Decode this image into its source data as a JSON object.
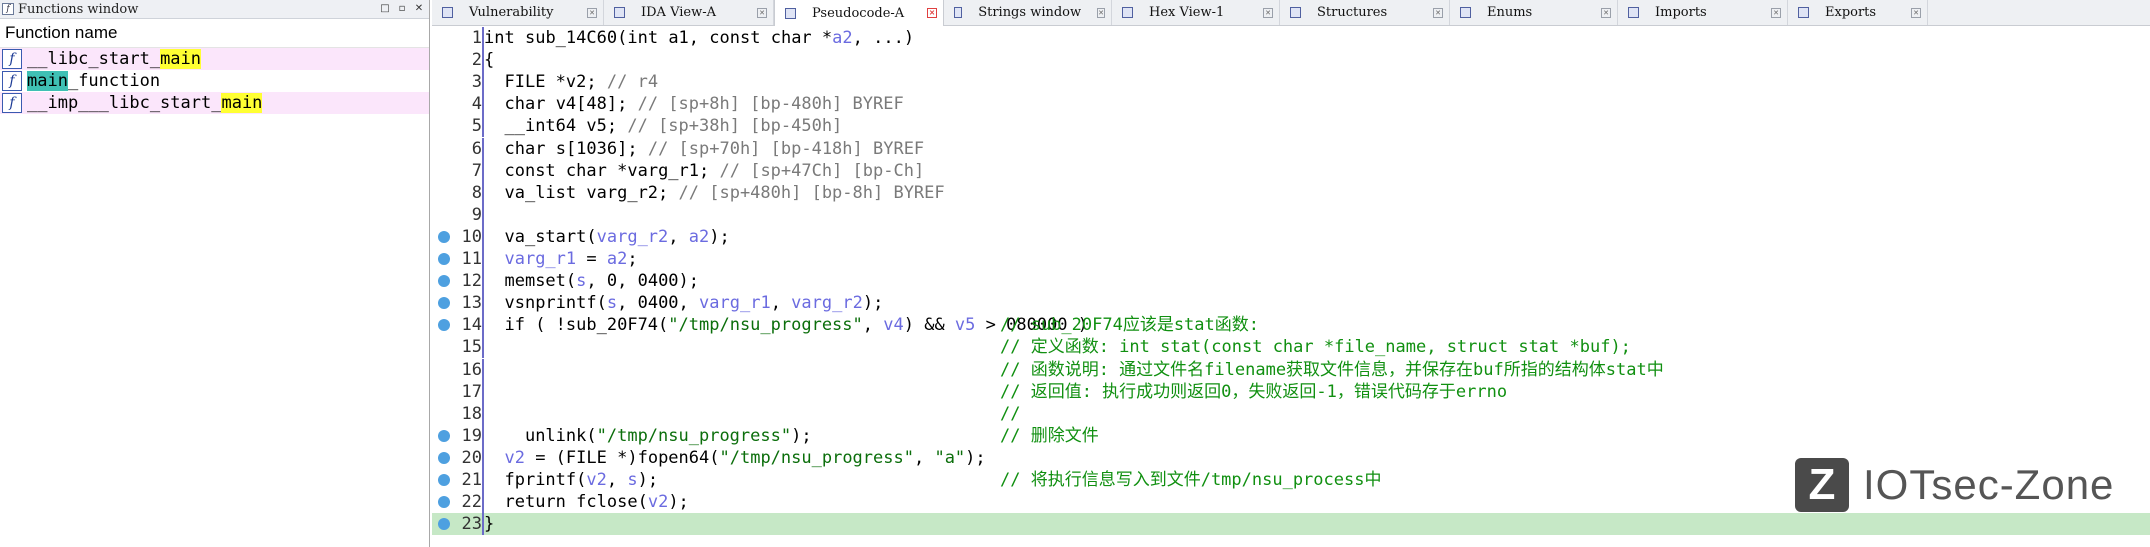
{
  "functions_window": {
    "title": "Functions window",
    "column_header": "Function name",
    "items": [
      {
        "pre": "__libc_start_",
        "hl": "main",
        "post": "",
        "hl_color": "yellow",
        "pink": true
      },
      {
        "pre": "",
        "hl": "main",
        "post": "_function",
        "hl_color": "cyan",
        "pink": false
      },
      {
        "pre": "__imp___libc_start_",
        "hl": "main",
        "post": "",
        "hl_color": "yellow",
        "pink": true
      }
    ]
  },
  "tabs": [
    {
      "label": "Vulnerability",
      "active": false
    },
    {
      "label": "IDA View-A",
      "active": false
    },
    {
      "label": "Pseudocode-A",
      "active": true
    },
    {
      "label": "Strings window",
      "active": false
    },
    {
      "label": "Hex View-1",
      "active": false
    },
    {
      "label": "Structures",
      "active": false
    },
    {
      "label": "Enums",
      "active": false
    },
    {
      "label": "Imports",
      "active": false
    },
    {
      "label": "Exports",
      "active": false
    }
  ],
  "code": {
    "current_line": 23,
    "lines": [
      {
        "n": "1",
        "bp": false,
        "text": "int sub_14C60(int a1, const char *a2, ...)",
        "comment": ""
      },
      {
        "n": "2",
        "bp": false,
        "text": "{",
        "comment": ""
      },
      {
        "n": "3",
        "bp": false,
        "text": "  FILE *v2; // r4",
        "comment": ""
      },
      {
        "n": "4",
        "bp": false,
        "text": "  char v4[48]; // [sp+8h] [bp-480h] BYREF",
        "comment": ""
      },
      {
        "n": "5",
        "bp": false,
        "text": "  __int64 v5; // [sp+38h] [bp-450h]",
        "comment": ""
      },
      {
        "n": "6",
        "bp": false,
        "text": "  char s[1036]; // [sp+70h] [bp-418h] BYREF",
        "comment": ""
      },
      {
        "n": "7",
        "bp": false,
        "text": "  const char *varg_r1; // [sp+47Ch] [bp-Ch]",
        "comment": ""
      },
      {
        "n": "8",
        "bp": false,
        "text": "  va_list varg_r2; // [sp+480h] [bp-8h] BYREF",
        "comment": ""
      },
      {
        "n": "9",
        "bp": false,
        "text": "",
        "comment": ""
      },
      {
        "n": "10",
        "bp": true,
        "text": "  va_start(varg_r2, a2);",
        "comment": ""
      },
      {
        "n": "11",
        "bp": true,
        "text": "  varg_r1 = a2;",
        "comment": ""
      },
      {
        "n": "12",
        "bp": true,
        "text": "  memset(s, 0, 0x400u);",
        "comment": ""
      },
      {
        "n": "13",
        "bp": true,
        "text": "  vsnprintf(s, 0x400u, varg_r1, varg_r2);",
        "comment": ""
      },
      {
        "n": "14",
        "bp": true,
        "text": "  if ( !sub_20F74(\"/tmp/nsu_progress\", v4) && v5 > 0x80000 )",
        "comment": "// sub_20F74应该是stat函数:"
      },
      {
        "n": "15",
        "bp": false,
        "text": "",
        "comment": "// 定义函数: int stat(const char *file_name, struct stat *buf);"
      },
      {
        "n": "16",
        "bp": false,
        "text": "",
        "comment": "// 函数说明: 通过文件名filename获取文件信息，并保存在buf所指的结构体stat中"
      },
      {
        "n": "17",
        "bp": false,
        "text": "",
        "comment": "// 返回值: 执行成功则返回0，失败返回-1，错误代码存于errno"
      },
      {
        "n": "18",
        "bp": false,
        "text": "",
        "comment": "//"
      },
      {
        "n": "19",
        "bp": true,
        "text": "    unlink(\"/tmp/nsu_progress\");",
        "comment": "// 删除文件"
      },
      {
        "n": "20",
        "bp": true,
        "text": "  v2 = (FILE *)fopen64(\"/tmp/nsu_progress\", \"a\");",
        "comment": ""
      },
      {
        "n": "21",
        "bp": true,
        "text": "  fprintf(v2, s);",
        "comment": "// 将执行信息写入到文件/tmp/nsu_process中"
      },
      {
        "n": "22",
        "bp": true,
        "text": "  return fclose(v2);",
        "comment": ""
      },
      {
        "n": "23",
        "bp": true,
        "text": "}",
        "comment": ""
      }
    ]
  },
  "watermark": {
    "logo": "Z",
    "text": "IOTsec-Zone"
  }
}
